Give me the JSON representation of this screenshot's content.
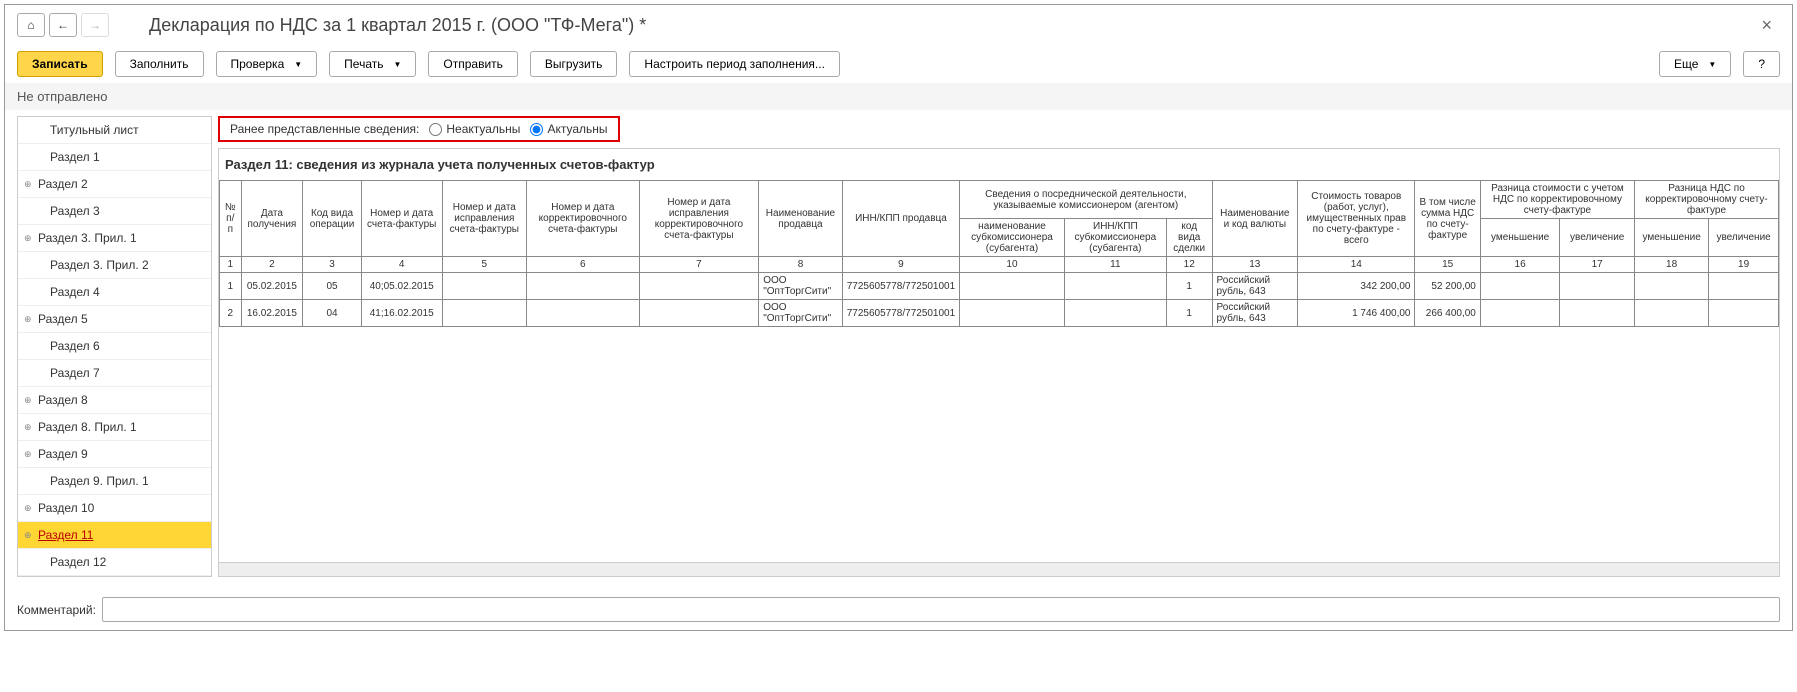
{
  "title": "Декларация по НДС за 1 квартал 2015 г. (ООО \"ТФ-Мега\") *",
  "toolbar": {
    "save": "Записать",
    "fill": "Заполнить",
    "check": "Проверка",
    "print": "Печать",
    "send": "Отправить",
    "export": "Выгрузить",
    "period": "Настроить период заполнения...",
    "more": "Еще",
    "help": "?"
  },
  "status": "Не отправлено",
  "sidebar": [
    {
      "label": "Титульный лист",
      "indent": true
    },
    {
      "label": "Раздел 1",
      "indent": true
    },
    {
      "label": "Раздел 2",
      "marker": "⊕"
    },
    {
      "label": "Раздел 3",
      "indent": true
    },
    {
      "label": "Раздел 3. Прил. 1",
      "marker": "⊕"
    },
    {
      "label": "Раздел 3. Прил. 2",
      "indent": true
    },
    {
      "label": "Раздел 4",
      "indent": true
    },
    {
      "label": "Раздел 5",
      "marker": "⊕"
    },
    {
      "label": "Раздел 6",
      "indent": true
    },
    {
      "label": "Раздел 7",
      "indent": true
    },
    {
      "label": "Раздел 8",
      "marker": "⊕"
    },
    {
      "label": "Раздел 8. Прил. 1",
      "marker": "⊕"
    },
    {
      "label": "Раздел 9",
      "marker": "⊕"
    },
    {
      "label": "Раздел 9. Прил. 1",
      "indent": true
    },
    {
      "label": "Раздел 10",
      "marker": "⊕"
    },
    {
      "label": "Раздел 11",
      "marker": "⊕",
      "selected": true
    },
    {
      "label": "Раздел 12",
      "indent": true
    }
  ],
  "radio": {
    "label": "Ранее представленные сведения:",
    "opt1": "Неактуальны",
    "opt2": "Актуальны"
  },
  "section_title": "Раздел 11: сведения из журнала учета полученных счетов-фактур",
  "headers": {
    "c1": "№ п/п",
    "c2": "Дата получения",
    "c3": "Код вида операции",
    "c4": "Номер и дата счета-фактуры",
    "c5": "Номер и дата исправления счета-фактуры",
    "c6": "Номер и дата корректировочного счета-фактуры",
    "c7": "Номер и дата исправления корректировочного счета-фактуры",
    "c8": "Наименование продавца",
    "c9": "ИНН/КПП продавца",
    "c10_top": "Сведения о посреднической деятельности, указываемые комиссионером (агентом)",
    "c10a": "наименование субкомиссионера (субагента)",
    "c10b": "ИНН/КПП субкомиссионера (субагента)",
    "c10c": "код вида сделки",
    "c13": "Наименование и код валюты",
    "c14": "Стоимость товаров (работ, услуг), имущественных прав по счету-фактуре - всего",
    "c15": "В том числе сумма НДС по счету-фактуре",
    "c16_top": "Разница стоимости с учетом НДС по корректировочному счету-фактуре",
    "c16a": "уменьшение",
    "c16b": "увеличение",
    "c18_top": "Разница НДС по корректировочному счету-фактуре",
    "c18a": "уменьшение",
    "c18b": "увеличение"
  },
  "idx": {
    "n1": "1",
    "n2": "2",
    "n3": "3",
    "n4": "4",
    "n5": "5",
    "n6": "6",
    "n7": "7",
    "n8": "8",
    "n9": "9",
    "n10": "10",
    "n11": "11",
    "n12": "12",
    "n13": "13",
    "n14": "14",
    "n15": "15",
    "n16": "16",
    "n17": "17",
    "n18": "18",
    "n19": "19"
  },
  "rows": [
    {
      "n": "1",
      "date": "05.02.2015",
      "code": "05",
      "num": "40;05.02.2015",
      "seller": "ООО \"ОптТоргСити\"",
      "inn": "7725605778/772501001",
      "deal": "1",
      "currency": "Российский рубль, 643",
      "cost": "342 200,00",
      "vat": "52 200,00"
    },
    {
      "n": "2",
      "date": "16.02.2015",
      "code": "04",
      "num": "41;16.02.2015",
      "seller": "ООО \"ОптТоргСити\"",
      "inn": "7725605778/772501001",
      "deal": "1",
      "currency": "Российский рубль, 643",
      "cost": "1 746 400,00",
      "vat": "266 400,00"
    }
  ],
  "comment_label": "Комментарий:"
}
